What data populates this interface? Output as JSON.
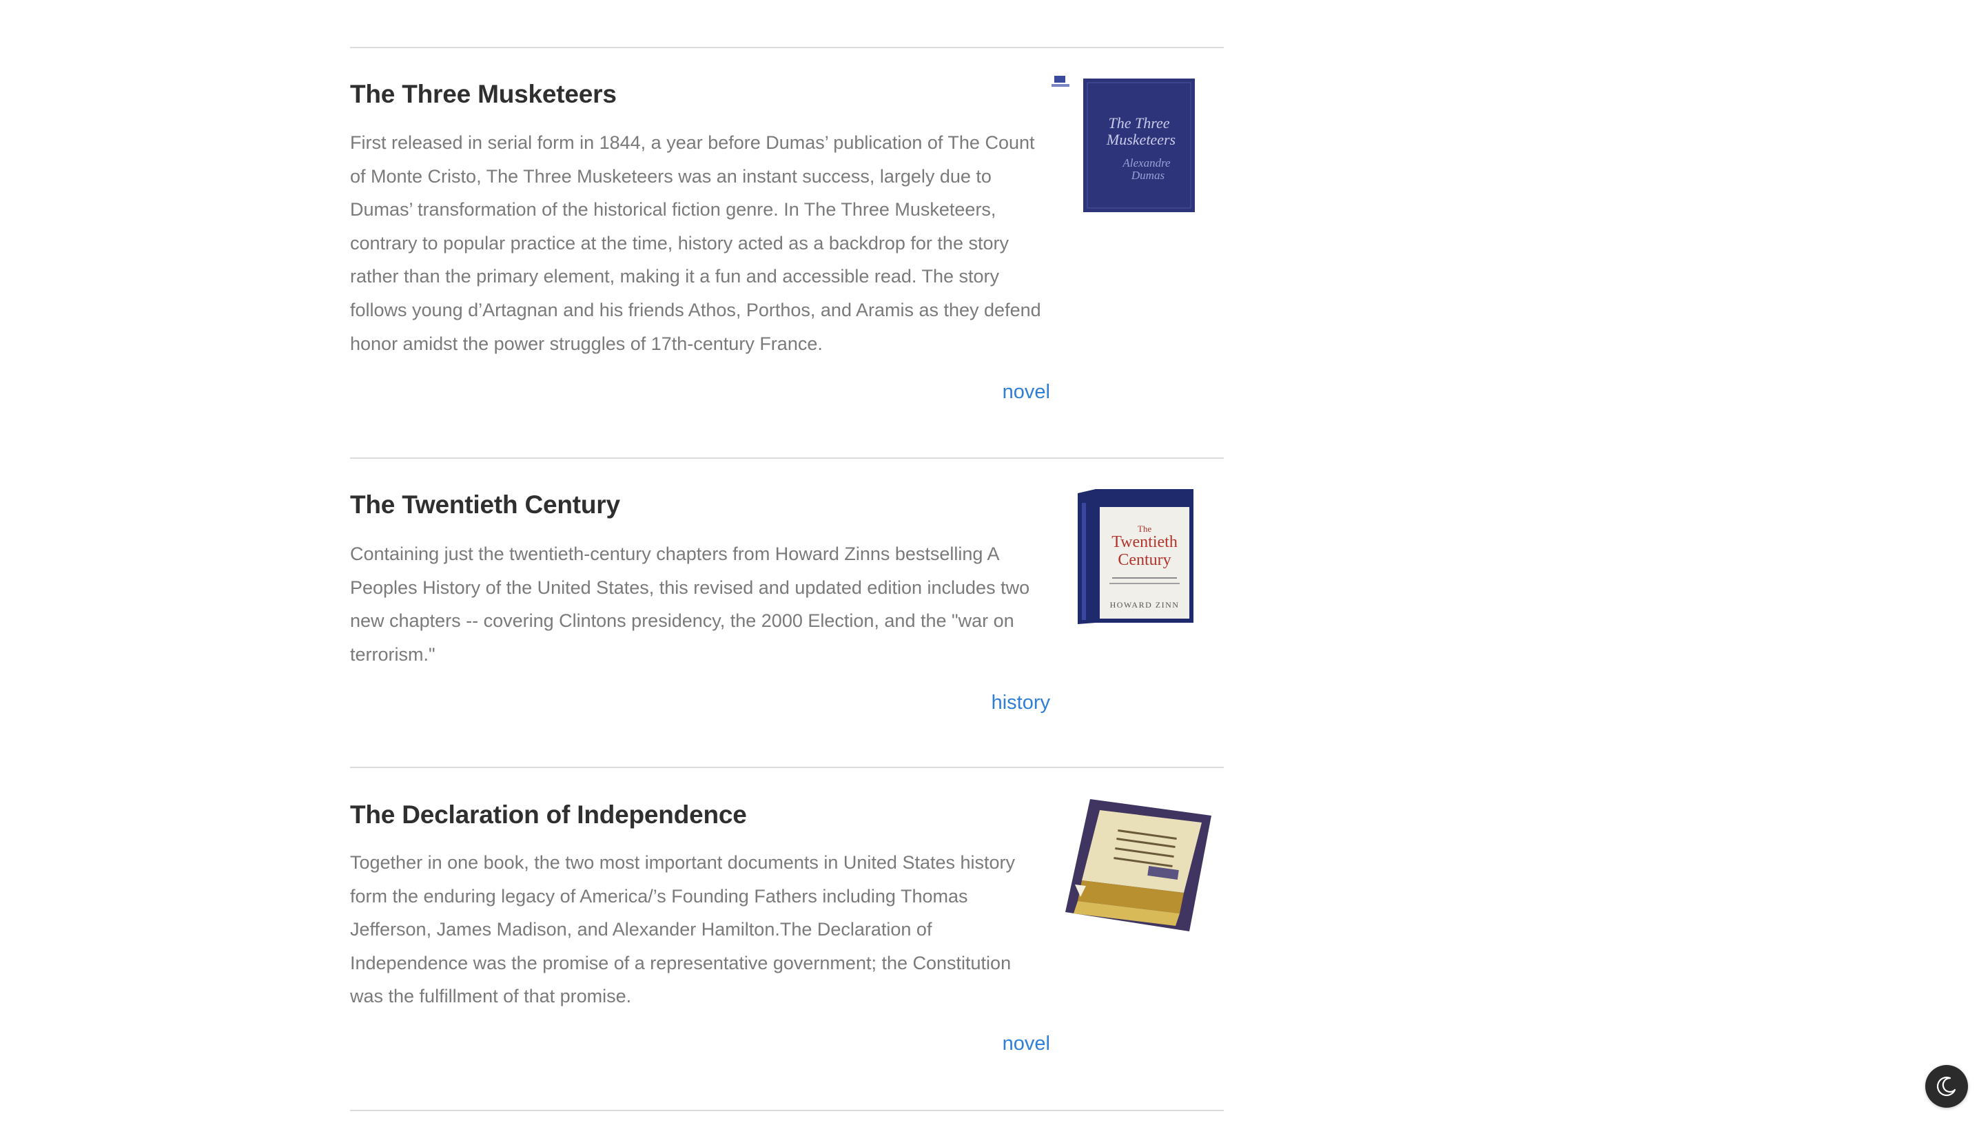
{
  "articles": [
    {
      "title": "The Three Musketeers",
      "description": "First released in serial form in 1844, a year before Dumas’ publication of The Count of Monte Cristo, The Three Musketeers was an instant success, largely due to Dumas’ transformation of the historical fiction genre. In The Three Musketeers, contrary to popular practice at the time, history acted as a backdrop for the story rather than the primary element, making it a fun and accessible read. The story follows young d’Artagnan and his friends Athos, Porthos, and Aramis as they defend honor amidst the power struggles of 17th-century France.",
      "tag": "novel",
      "cover": {
        "title_line1": "The Three",
        "title_line2": "Musketeers",
        "author_line1": "Alexandre",
        "author_line2": "Dumas",
        "color": "#2d3479"
      }
    },
    {
      "title": "The Twentieth Century",
      "description": "Containing just the twentieth-century chapters from Howard Zinns bestselling A Peoples History of the United States, this revised and updated edition includes two new chapters -- covering Clintons presidency, the 2000 Election, and the \"war on terrorism.\"",
      "tag": "history",
      "cover": {
        "title_line1": "The",
        "title_line2": "Twentieth",
        "title_line3": "Century",
        "author": "HOWARD ZINN",
        "color": "#1e2a6b"
      }
    },
    {
      "title": "The Declaration of Independence",
      "description": "Together in one book, the two most important documents in United States history form the enduring legacy of America/’s Founding Fathers including Thomas Jefferson, James Madison, and Alexander Hamilton.The Declaration of Independence was the promise of a representative government; the Constitution was the fulfillment of that promise.",
      "tag": "novel",
      "cover": {
        "color": "#5a4a7a"
      }
    }
  ],
  "dark_mode_toggle": {
    "icon": "moon-icon"
  }
}
